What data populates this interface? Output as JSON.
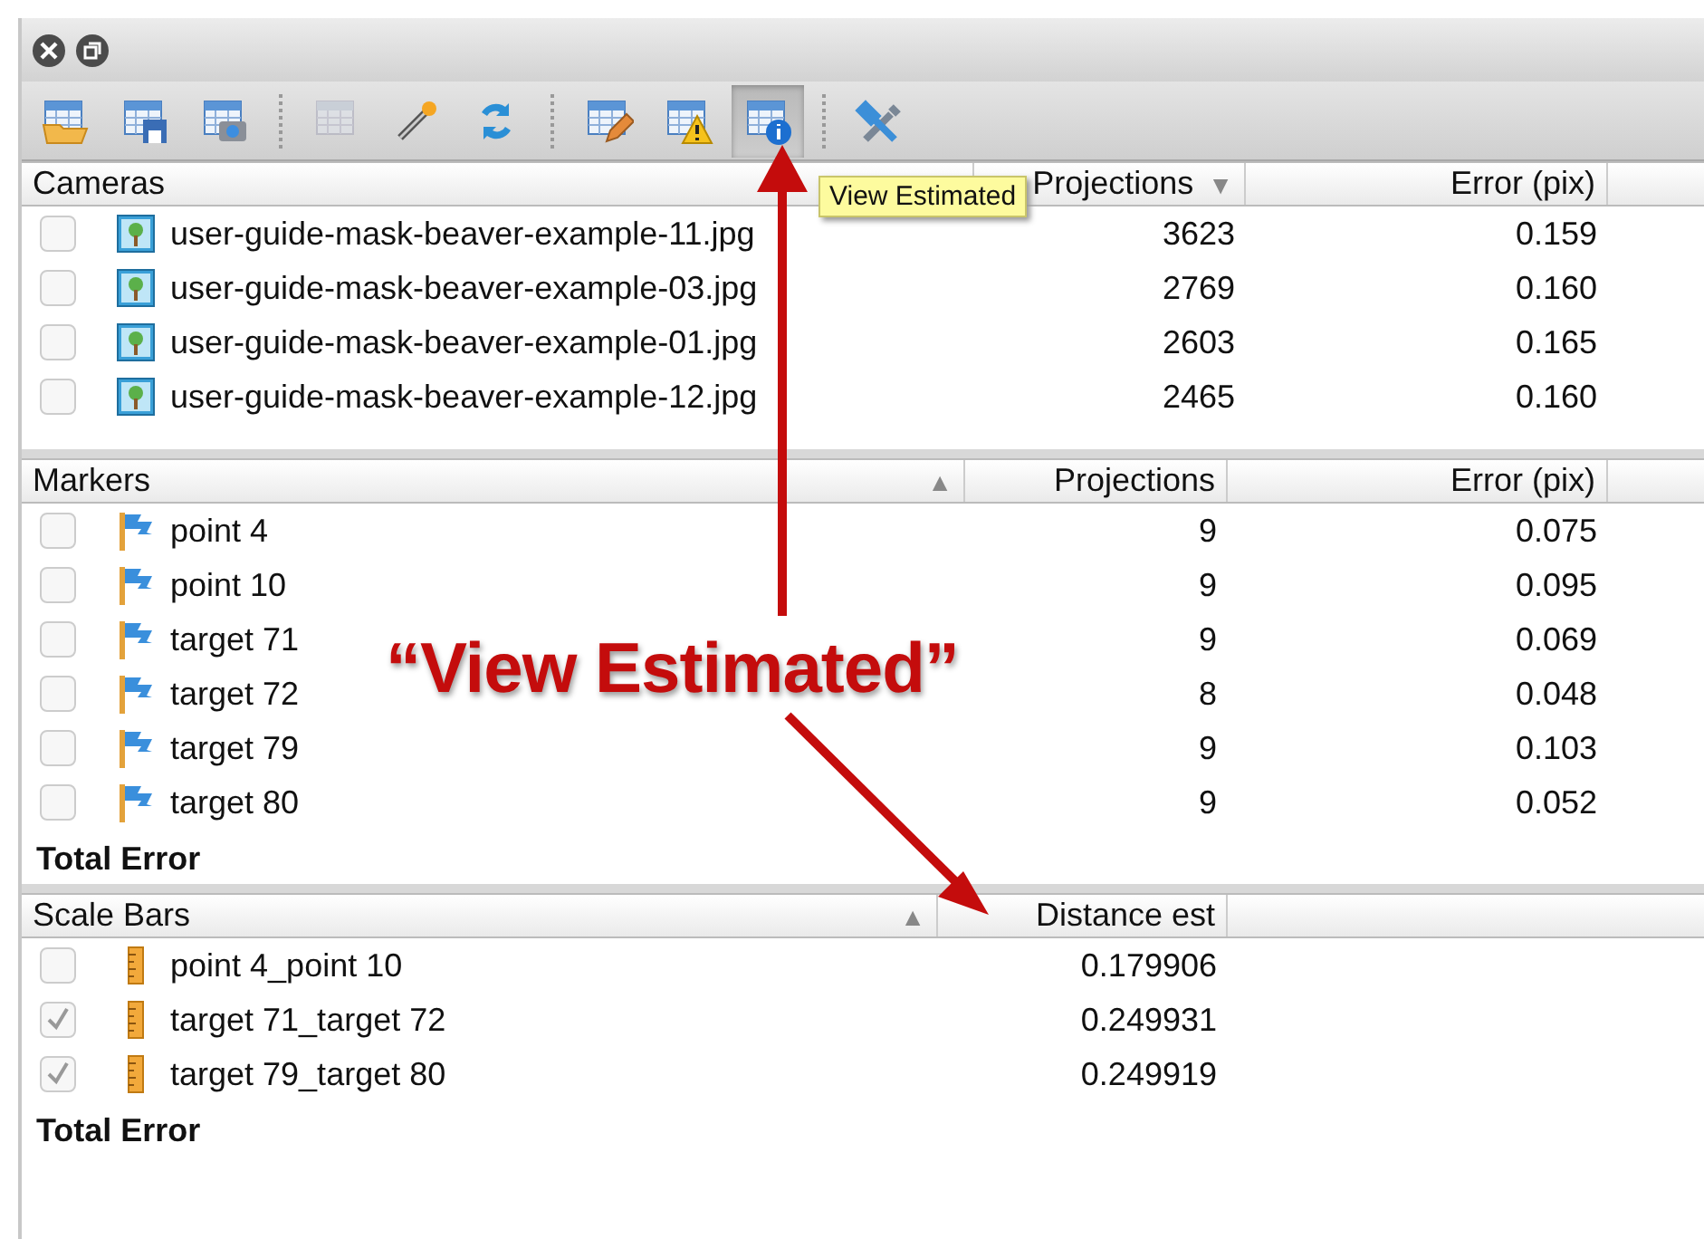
{
  "toolbar": [
    {
      "pressed": false,
      "disabled": false
    },
    {
      "pressed": false,
      "disabled": false
    },
    {
      "pressed": false,
      "disabled": false
    },
    {
      "pressed": false,
      "disabled": true
    },
    {
      "pressed": false,
      "disabled": false
    },
    {
      "pressed": false,
      "disabled": false
    },
    {
      "pressed": false,
      "disabled": false
    },
    {
      "pressed": false,
      "disabled": false
    },
    {
      "pressed": true,
      "disabled": false
    },
    {
      "pressed": false,
      "disabled": false
    }
  ],
  "tooltip": "View Estimated",
  "panels": [
    {
      "kind": "cameras",
      "columns": [
        {
          "label": "Cameras"
        },
        {
          "label": "Projections",
          "sort_indicator": "▼"
        },
        {
          "label": "Error (pix)"
        }
      ],
      "rows": [
        {
          "checked": false,
          "cells": [
            "user-guide-mask-beaver-example-11.jpg",
            "3623",
            "0.159"
          ]
        },
        {
          "checked": false,
          "cells": [
            "user-guide-mask-beaver-example-03.jpg",
            "2769",
            "0.160"
          ]
        },
        {
          "checked": false,
          "cells": [
            "user-guide-mask-beaver-example-01.jpg",
            "2603",
            "0.165"
          ]
        },
        {
          "checked": false,
          "cells": [
            "user-guide-mask-beaver-example-12.jpg",
            "2465",
            "0.160"
          ]
        }
      ]
    },
    {
      "kind": "markers",
      "columns": [
        {
          "label": "Markers",
          "sort_indicator": "▲"
        },
        {
          "label": "Projections"
        },
        {
          "label": "Error (pix)"
        }
      ],
      "rows": [
        {
          "checked": false,
          "cells": [
            "point 4",
            "9",
            "0.075"
          ]
        },
        {
          "checked": false,
          "cells": [
            "point 10",
            "9",
            "0.095"
          ]
        },
        {
          "checked": false,
          "cells": [
            "target 71",
            "9",
            "0.069"
          ]
        },
        {
          "checked": false,
          "cells": [
            "target 72",
            "8",
            "0.048"
          ]
        },
        {
          "checked": false,
          "cells": [
            "target 79",
            "9",
            "0.103"
          ]
        },
        {
          "checked": false,
          "cells": [
            "target 80",
            "9",
            "0.052"
          ]
        }
      ],
      "total": "Total Error"
    },
    {
      "kind": "scalebars",
      "columns": [
        {
          "label": "Scale Bars",
          "sort_indicator": "▲"
        },
        {
          "label": "Distance est"
        }
      ],
      "rows": [
        {
          "checked": false,
          "cells": [
            "point 4_point 10",
            "0.179906"
          ]
        },
        {
          "checked": true,
          "cells": [
            "target 71_target 72",
            "0.249931"
          ]
        },
        {
          "checked": true,
          "cells": [
            "target 79_target 80",
            "0.249919"
          ]
        }
      ],
      "total": "Total Error"
    }
  ],
  "callout": "“View Estimated”"
}
